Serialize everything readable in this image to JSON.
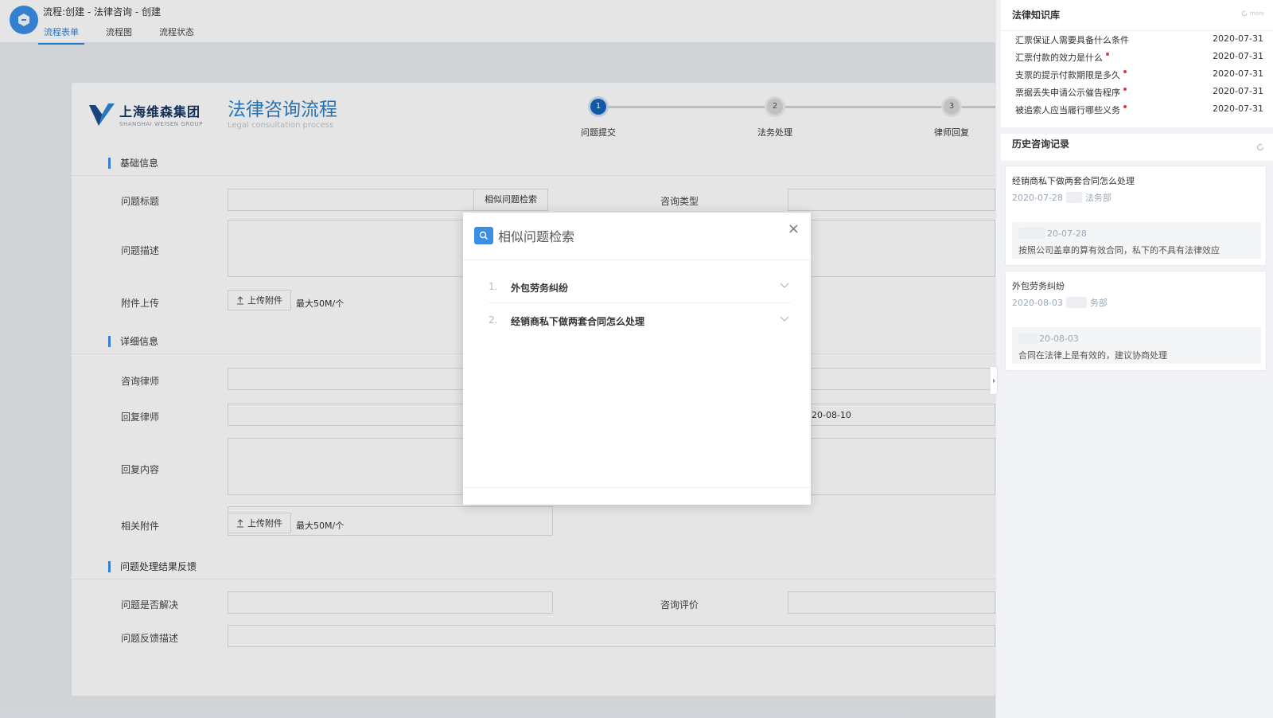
{
  "app": {
    "title": "流程:创建 - 法律咨询 - 创建",
    "tabs": [
      "流程表单",
      "流程图",
      "流程状态"
    ]
  },
  "brand": {
    "name": "上海维森集团",
    "sub": "SHANGHAI WEISEN GROUP"
  },
  "form": {
    "title": "法律咨询流程",
    "subtitle": "Legal consultation process",
    "steps": [
      {
        "num": "1",
        "label": "问题提交",
        "active": true
      },
      {
        "num": "2",
        "label": "法务处理",
        "active": false
      },
      {
        "num": "3",
        "label": "律师回复",
        "active": false
      }
    ],
    "section_basic": "基础信息",
    "section_detail": "详细信息",
    "section_feedback": "问题处理结果反馈",
    "labels": {
      "title": "问题标题",
      "search_btn": "相似问题检索",
      "type": "咨询类型",
      "desc": "问题描述",
      "attach": "附件上传",
      "lawyer": "咨询律师",
      "reply_lawyer": "回复律师",
      "reply_content": "回复内容",
      "related_attach": "相关附件",
      "resolved": "问题是否解决",
      "rating": "咨询评价",
      "feedback_desc": "问题反馈描述"
    },
    "upload_btn": "上传附件",
    "upload_hint": "最大50M/个",
    "partial_date": "20-08-10"
  },
  "modal": {
    "title": "相似问题检索",
    "close": "×",
    "items": [
      {
        "num": "1.",
        "text": "外包劳务纠纷"
      },
      {
        "num": "2.",
        "text": "经销商私下做两套合同怎么处理"
      }
    ]
  },
  "kb": {
    "title": "法律知识库",
    "more": "more",
    "rows": [
      {
        "text": "汇票保证人需要具备什么条件",
        "date": "2020-07-31",
        "new": false
      },
      {
        "text": "汇票付款的效力是什么",
        "date": "2020-07-31",
        "new": true
      },
      {
        "text": "支票的提示付款期限是多久",
        "date": "2020-07-31",
        "new": true
      },
      {
        "text": "票据丢失申请公示催告程序",
        "date": "2020-07-31",
        "new": true
      },
      {
        "text": "被追索人应当履行哪些义务",
        "date": "2020-07-31",
        "new": true
      }
    ]
  },
  "history": {
    "title": "历史咨询记录",
    "cards": [
      {
        "question": "经销商私下做两套合同怎么处理",
        "date": "2020-07-28",
        "dept": "法务部",
        "reply_date": "20-07-28",
        "reply": "按照公司盖章的算有效合同，私下的不具有法律效应"
      },
      {
        "question": "外包劳务纠纷",
        "date": "2020-08-03",
        "dept": "务部",
        "reply_date": "20-08-03",
        "reply": "合同在法律上是有效的，建议协商处理"
      }
    ]
  },
  "colors": {
    "accent": "#3a8ee6",
    "title": "#2a80cc",
    "step_active": "#1565b8",
    "new_dot": "#e53935"
  }
}
